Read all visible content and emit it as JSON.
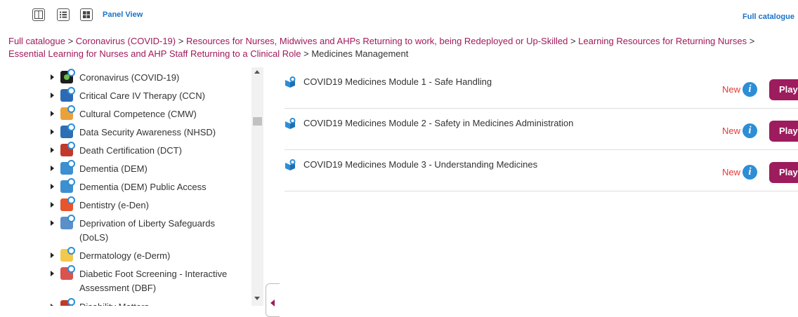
{
  "toolbar": {
    "panel_view_label": "Panel View",
    "full_catalogue_label": "Full catalogue"
  },
  "breadcrumb": {
    "links": [
      "Full catalogue",
      "Coronavirus (COVID-19)",
      "Resources for Nurses, Midwives and AHPs Returning to work, being Redeployed or Up-Skilled",
      "Learning Resources for Returning Nurses",
      "Essential Learning for Nurses and AHP Staff Returning to a Clinical Role"
    ],
    "separator": ">",
    "current": "Medicines Management"
  },
  "tree": {
    "items": [
      {
        "label": "Coronavirus (COVID-19)",
        "icon": "covid-icon",
        "color": "#1d1d1d"
      },
      {
        "label": "Critical Care IV Therapy (CCN)",
        "icon": "critical-care-icon",
        "color": "#2d6ab6"
      },
      {
        "label": "Cultural Competence (CMW)",
        "icon": "cultural-competence-icon",
        "color": "#e9a13b"
      },
      {
        "label": "Data Security Awareness (NHSD)",
        "icon": "data-security-icon",
        "color": "#2c6fb4"
      },
      {
        "label": "Death Certification (DCT)",
        "icon": "death-certification-icon",
        "color": "#c0392b"
      },
      {
        "label": "Dementia (DEM)",
        "icon": "dementia-icon",
        "color": "#3d8fd0"
      },
      {
        "label": "Dementia (DEM) Public Access",
        "icon": "dementia-public-icon",
        "color": "#3d8fd0"
      },
      {
        "label": "Dentistry (e-Den)",
        "icon": "dentistry-icon",
        "color": "#e8542b"
      },
      {
        "label": "Deprivation of Liberty Safeguards (DoLS)",
        "icon": "dols-icon",
        "color": "#5b8fc7"
      },
      {
        "label": "Dermatology (e-Derm)",
        "icon": "dermatology-icon",
        "color": "#f2c94c"
      },
      {
        "label": "Diabetic Foot Screening - Interactive Assessment (DBF)",
        "icon": "diabetic-foot-icon",
        "color": "#d9534f"
      },
      {
        "label": "Disability Matters",
        "icon": "disability-icon",
        "color": "#c0392b"
      }
    ]
  },
  "modules": [
    {
      "title": "COVID19 Medicines Module 1 - Safe Handling",
      "badge": "New",
      "info": "i",
      "play": "Play"
    },
    {
      "title": "COVID19 Medicines Module 2 - Safety in Medicines Administration",
      "badge": "New",
      "info": "i",
      "play": "Play"
    },
    {
      "title": "COVID19 Medicines Module 3 - Understanding Medicines",
      "badge": "New",
      "info": "i",
      "play": "Play"
    }
  ],
  "colors": {
    "accent": "#9c1c5e",
    "link_blue": "#1a73c8",
    "new_red": "#e53935",
    "info_blue": "#2d8ed6"
  }
}
